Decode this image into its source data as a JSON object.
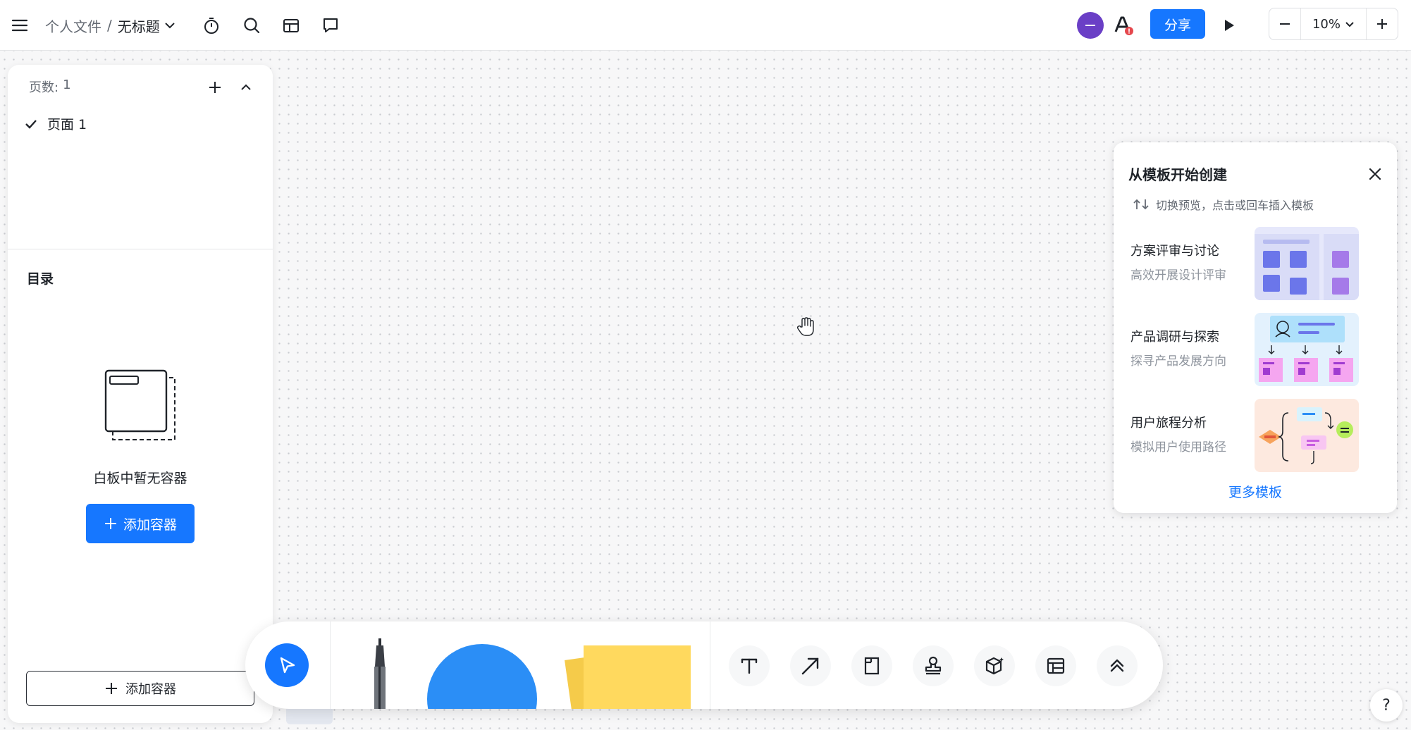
{
  "topbar": {
    "menu_icon": "hamburger-menu-icon",
    "breadcrumb_parent": "个人文件",
    "breadcrumb_separator": "/",
    "doc_title": "无标题",
    "tools": [
      "timer-icon",
      "search-icon",
      "folder-icon",
      "comment-icon"
    ],
    "share_label": "分享",
    "zoom_value": "10%"
  },
  "pages_panel": {
    "count_label": "页数:",
    "count_value": "1",
    "pages": [
      {
        "label": "页面 1",
        "selected": true
      }
    ]
  },
  "toc": {
    "title": "目录",
    "empty_text": "白板中暂无容器",
    "add_button_primary": "添加容器",
    "add_button_secondary": "添加容器"
  },
  "templates": {
    "title": "从模板开始创建",
    "hint": "切换预览，点击或回车插入模板",
    "items": [
      {
        "title": "方案评审与讨论",
        "subtitle": "高效开展设计评审"
      },
      {
        "title": "产品调研与探索",
        "subtitle": "探寻产品发展方向"
      },
      {
        "title": "用户旅程分析",
        "subtitle": "模拟用户使用路径"
      }
    ],
    "more_label": "更多模板"
  },
  "toolbar": {
    "tools": [
      "select-tool",
      "pen-tool",
      "shape-tool",
      "sticky-note-tool",
      "text-tool",
      "arrow-tool",
      "frame-tool",
      "stamp-tool",
      "3d-object-tool",
      "table-tool",
      "expand-tool"
    ]
  },
  "help_label": "?",
  "colors": {
    "accent": "#1677ff",
    "avatar": "#6a3fc6",
    "sticky": "#ffd95e",
    "shape": "#2b8ef6"
  }
}
